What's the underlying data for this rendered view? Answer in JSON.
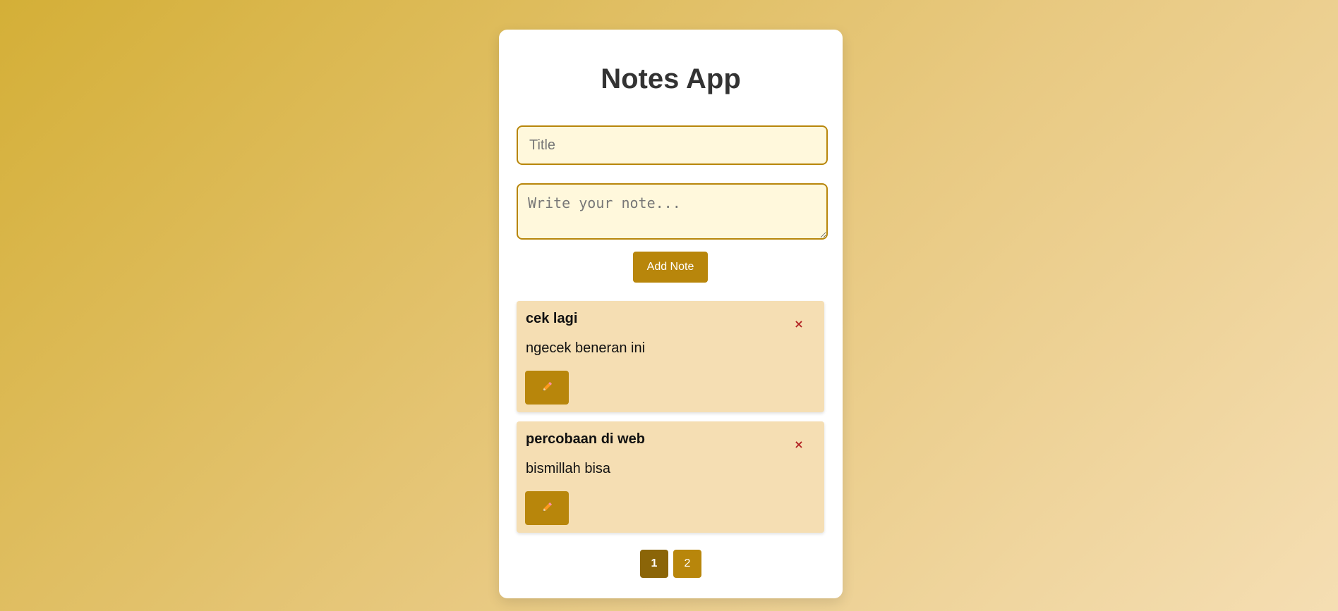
{
  "app": {
    "title": "Notes App"
  },
  "form": {
    "title_placeholder": "Title",
    "title_value": "",
    "note_placeholder": "Write your note...",
    "note_value": "",
    "add_label": "Add Note"
  },
  "notes": [
    {
      "title": "cek lagi",
      "body": "ngecek beneran ini",
      "delete_label": "×",
      "edit_icon": "pencil-icon"
    },
    {
      "title": "percobaan di web",
      "body": "bismillah bisa",
      "delete_label": "×",
      "edit_icon": "pencil-icon"
    }
  ],
  "pagination": {
    "pages": [
      "1",
      "2"
    ],
    "current": "1"
  },
  "colors": {
    "accent": "#b8860b",
    "accent_dark": "#8b6508",
    "note_bg": "#f5deb3",
    "input_bg": "#fff8dc",
    "delete": "#b22222"
  }
}
